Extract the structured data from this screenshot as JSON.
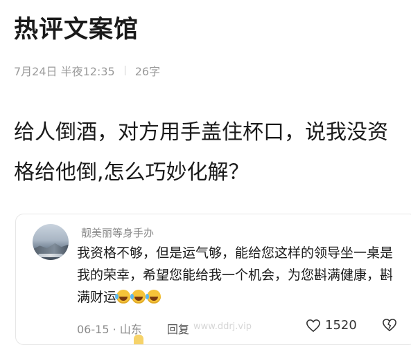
{
  "article": {
    "title": "热评文案馆",
    "date": "7月24日 半夜12:35",
    "word_count": "26字",
    "body": "给人倒酒，对方用手盖住杯口，说我没资格给他倒,怎么巧妙化解？"
  },
  "comment": {
    "username": "靓美丽等身手办",
    "text": "我资格不够，但是运气够，能给您这样的领导坐一桌是我的荣幸，希望您能给我一个机会，为您斟满健康，斟满财运",
    "emoji_count": 3,
    "date": "06-15 · 山东",
    "reply_label": "回复",
    "watermark": "www.ddrj.vip",
    "like_count": "1520"
  },
  "colors": {
    "title": "#1a1a1a",
    "meta": "#9a9a9a",
    "username": "#8a8a8a",
    "emoji": "#f6c43a"
  },
  "icons": {
    "like": "heart-icon",
    "dislike": "broken-heart-icon",
    "emoji": "tears-of-joy-emoji"
  }
}
